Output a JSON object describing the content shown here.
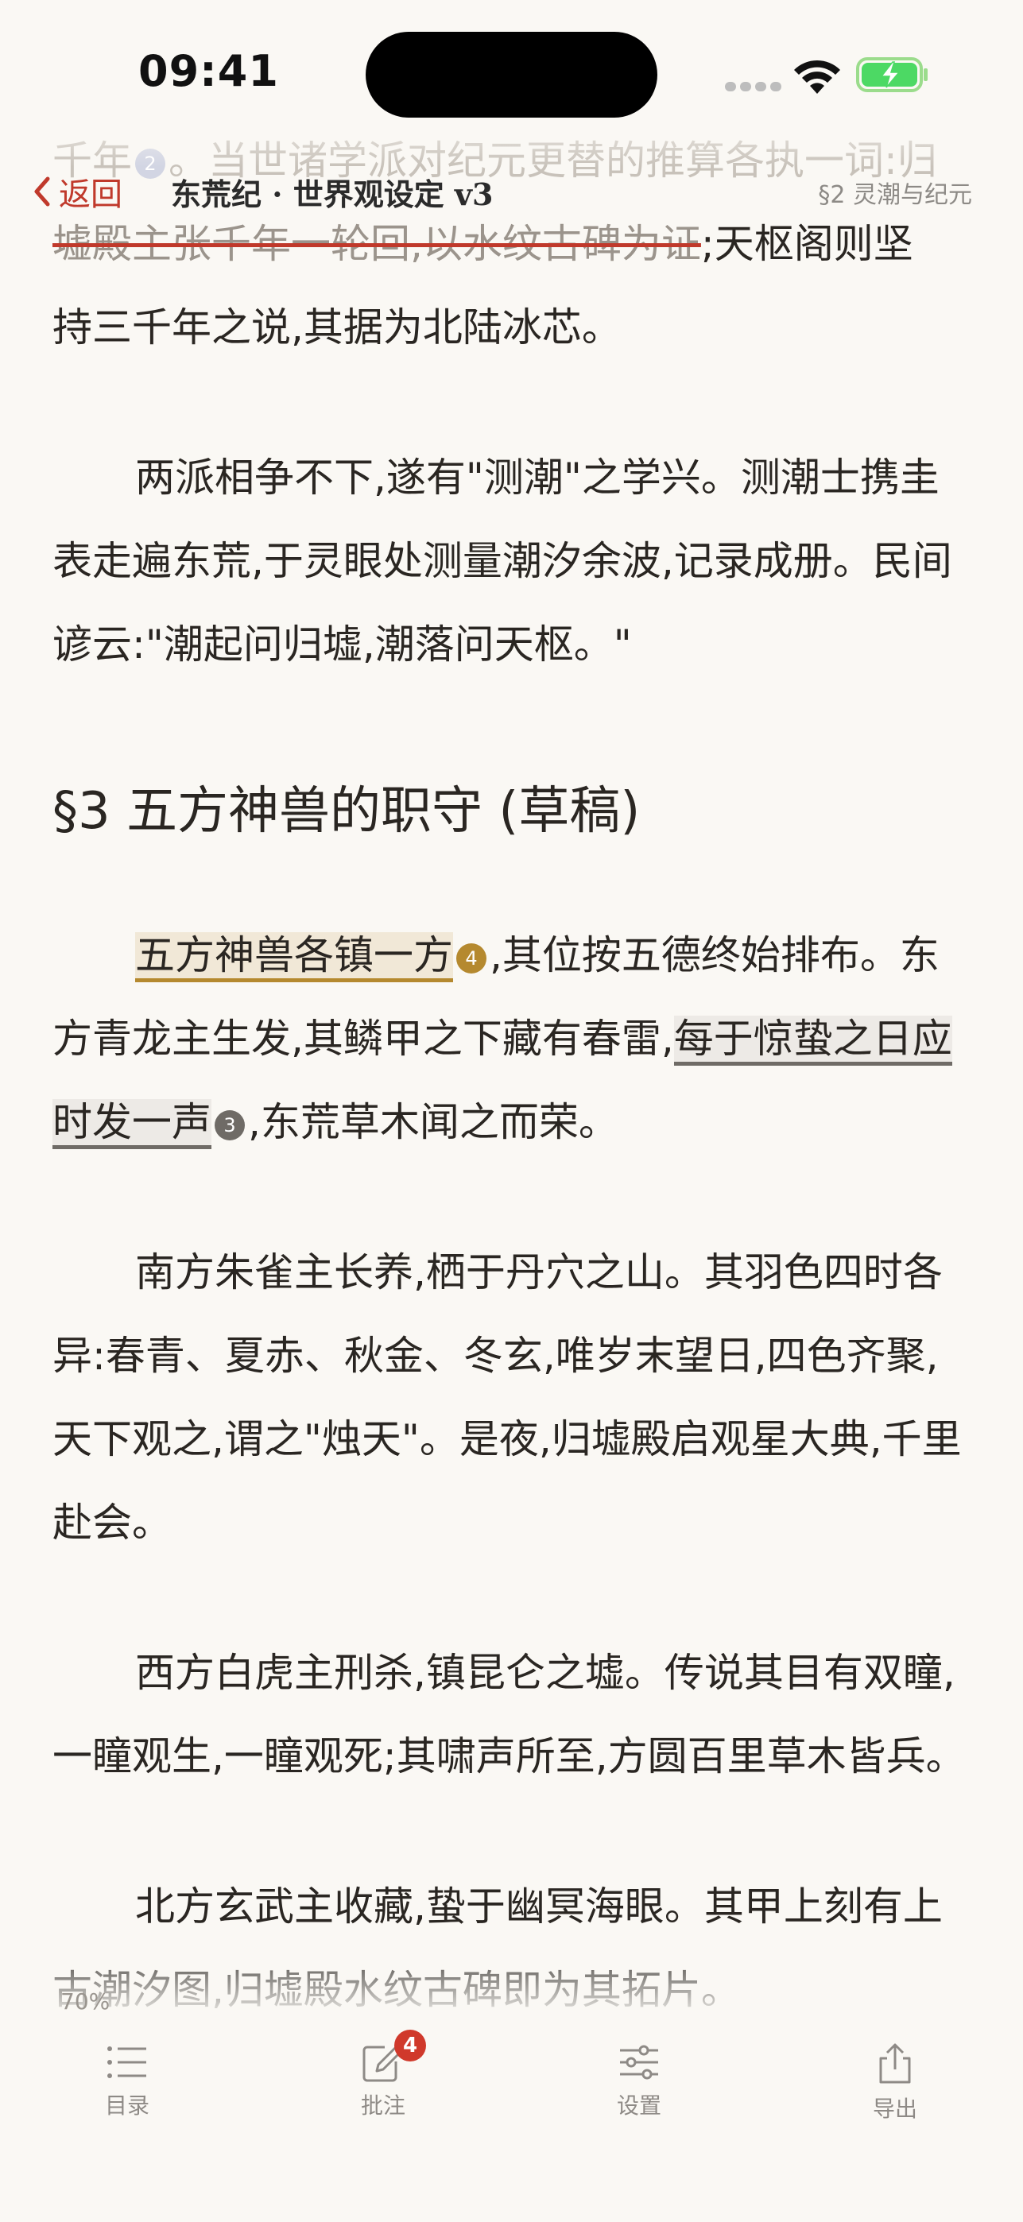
{
  "status_bar": {
    "time": "09:41"
  },
  "nav": {
    "back_label": "返回",
    "title": "东荒纪 · 世界观设定 v3",
    "section": "§2 灵潮与纪元"
  },
  "content": {
    "faded_top": "千年",
    "faded_top_badge": "2",
    "faded_top_rest": "。当世诸学派对纪元更替的推算各执一词:归",
    "struck_text": "墟殿主张千年一轮回,以水纹古碑为证",
    "after_strike": ";天枢阁则坚",
    "line3": "持三千年之说,其据为北陆冰芯。",
    "para2": "两派相争不下,遂有\"测潮\"之学兴。测潮士携圭表走遍东荒,于灵眼处测量潮汐余波,记录成册。民间谚云:\"潮起问归墟,潮落问天枢。\"",
    "heading": "§3 五方神兽的职守 (草稿)",
    "para3_hl1": "五方神兽各镇一方",
    "para3_badge1": "4",
    "para3_mid": ",其位按五德终始排布。东方青龙主生发,其鳞甲之下藏有春雷,",
    "para3_hl2": "每于惊蛰之日应时发一声",
    "para3_badge2": "3",
    "para3_end": ",东荒草木闻之而荣。",
    "para4": "南方朱雀主长养,栖于丹穴之山。其羽色四时各异:春青、夏赤、秋金、冬玄,唯岁末望日,四色齐聚,天下观之,谓之\"烛天\"。是夜,归墟殿启观星大典,千里赴会。",
    "para5": "西方白虎主刑杀,镇昆仑之墟。传说其目有双瞳,一瞳观生,一瞳观死;其啸声所至,方圆百里草木皆兵。",
    "para6": "北方玄武主收藏,蛰于幽冥海眼。其甲上刻有上古潮汐图,归墟殿水纹古碑即为其拓片。"
  },
  "reading_progress": "70%",
  "tabbar": {
    "toc": "目录",
    "notes": "批注",
    "notes_badge": "4",
    "settings": "设置",
    "export": "导出"
  },
  "colors": {
    "accent": "#C0392B",
    "highlight_gold": "#B5892F",
    "highlight_gray": "#6f6b66",
    "background": "#FAF8F4"
  }
}
